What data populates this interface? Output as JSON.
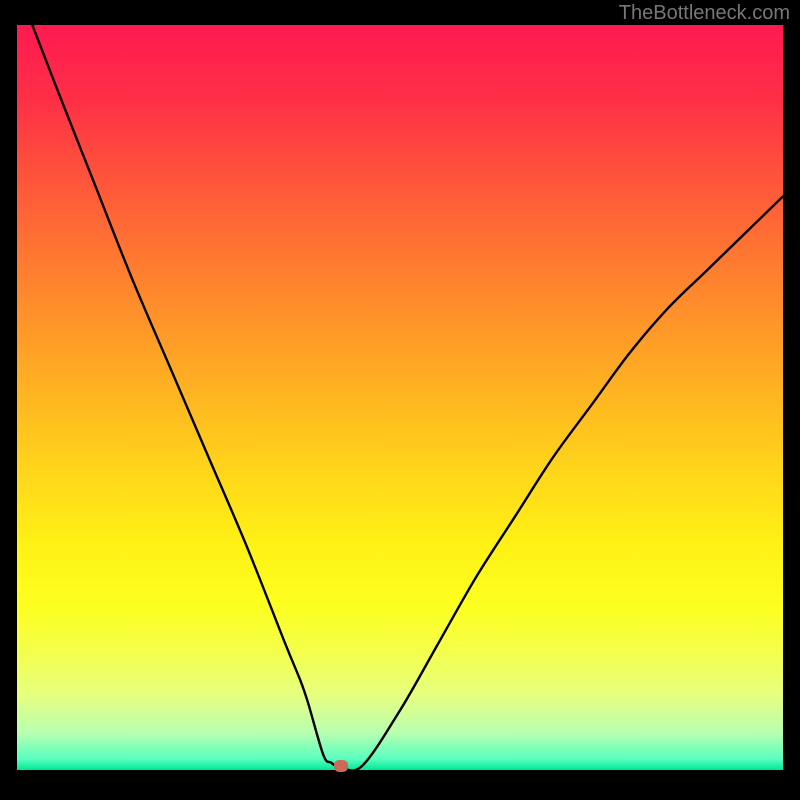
{
  "watermark": "TheBottleneck.com",
  "chart_data": {
    "type": "line",
    "title": "",
    "xlabel": "",
    "ylabel": "",
    "xlim": [
      0,
      100
    ],
    "ylim": [
      0,
      100
    ],
    "series": [
      {
        "name": "bottleneck-curve",
        "x": [
          2,
          5,
          10,
          15,
          20,
          25,
          30,
          35,
          37,
          38,
          40,
          41,
          42,
          45,
          50,
          55,
          60,
          65,
          70,
          75,
          80,
          85,
          90,
          95,
          100
        ],
        "y": [
          100,
          92,
          79,
          66,
          54,
          42,
          30,
          17,
          12,
          9,
          2,
          1,
          0.5,
          0.5,
          8,
          17,
          26,
          34,
          42,
          49,
          56,
          62,
          67,
          72,
          77
        ]
      }
    ],
    "marker": {
      "x": 42.3,
      "y": 0.5,
      "color": "#cc6a5a"
    },
    "gradient_stops": [
      {
        "pos": 0.0,
        "color": "#ff1a51"
      },
      {
        "pos": 0.1,
        "color": "#ff2f46"
      },
      {
        "pos": 0.2,
        "color": "#ff523b"
      },
      {
        "pos": 0.3,
        "color": "#ff7432"
      },
      {
        "pos": 0.4,
        "color": "#ff9529"
      },
      {
        "pos": 0.5,
        "color": "#ffb621"
      },
      {
        "pos": 0.6,
        "color": "#ffd61a"
      },
      {
        "pos": 0.7,
        "color": "#fff215"
      },
      {
        "pos": 0.78,
        "color": "#fdff20"
      },
      {
        "pos": 0.84,
        "color": "#f4ff4a"
      },
      {
        "pos": 0.9,
        "color": "#e6ff80"
      },
      {
        "pos": 0.95,
        "color": "#b8ffb0"
      },
      {
        "pos": 0.985,
        "color": "#5affc0"
      },
      {
        "pos": 1.0,
        "color": "#00e694"
      }
    ]
  }
}
